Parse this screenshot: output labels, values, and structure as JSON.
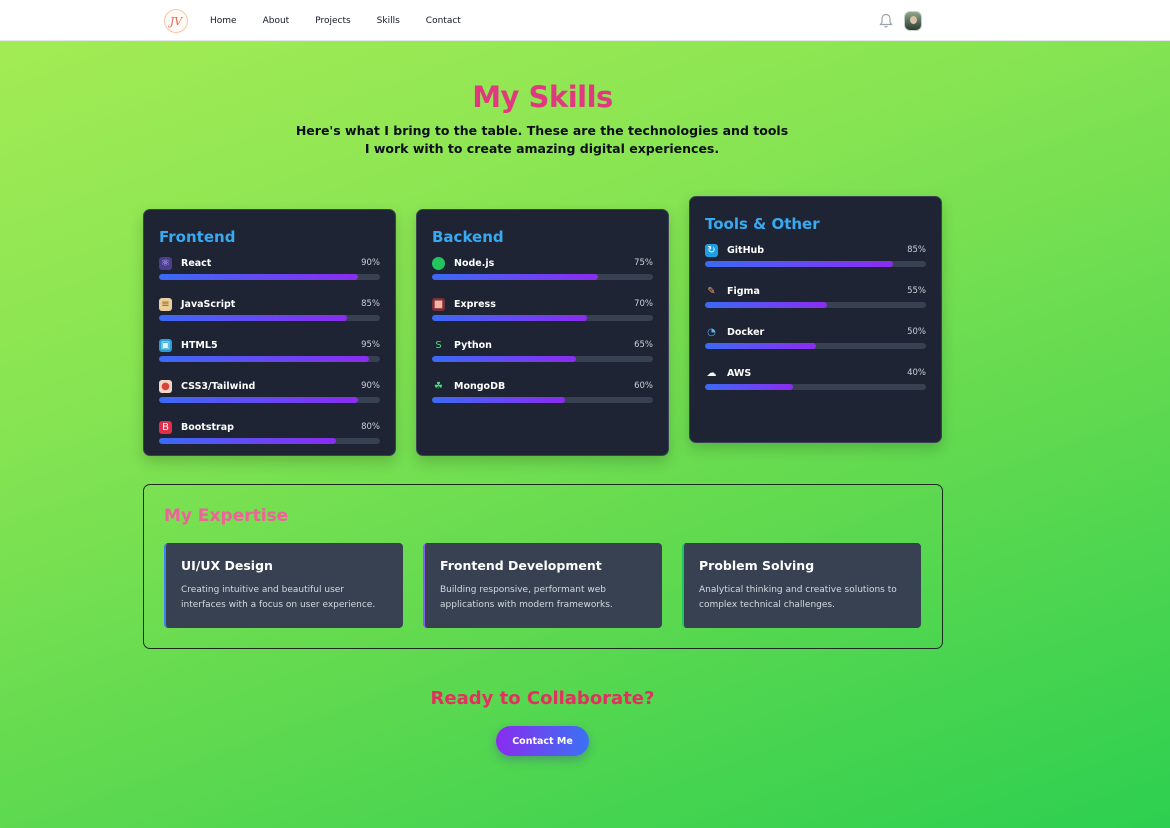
{
  "nav": {
    "logo_text": "JV",
    "links": [
      "Home",
      "About",
      "Projects",
      "Skills",
      "Contact"
    ],
    "icons": [
      "bell-icon",
      "avatar"
    ]
  },
  "hero": {
    "title": "My Skills",
    "subtitle": "Here's what I bring to the table. These are the technologies and tools I work with to create amazing digital experiences."
  },
  "skill_groups": [
    {
      "title": "Frontend",
      "skills": [
        {
          "name": "React",
          "percent": 90,
          "percent_label": "90%",
          "icon": "react-icon"
        },
        {
          "name": "JavaScript",
          "percent": 85,
          "percent_label": "85%",
          "icon": "scroll-icon"
        },
        {
          "name": "HTML5",
          "percent": 95,
          "percent_label": "95%",
          "icon": "monitor-icon"
        },
        {
          "name": "CSS3/Tailwind",
          "percent": 90,
          "percent_label": "90%",
          "icon": "palette-icon"
        },
        {
          "name": "Bootstrap",
          "percent": 80,
          "percent_label": "80%",
          "icon": "bootstrap-icon"
        }
      ]
    },
    {
      "title": "Backend",
      "skills": [
        {
          "name": "Node.js",
          "percent": 75,
          "percent_label": "75%",
          "icon": "green-circle-icon"
        },
        {
          "name": "Express",
          "percent": 70,
          "percent_label": "70%",
          "icon": "train-icon"
        },
        {
          "name": "Python",
          "percent": 65,
          "percent_label": "65%",
          "icon": "snake-icon"
        },
        {
          "name": "MongoDB",
          "percent": 60,
          "percent_label": "60%",
          "icon": "leaf-icon"
        }
      ]
    },
    {
      "title": "Tools & Other",
      "skills": [
        {
          "name": "GitHub",
          "percent": 85,
          "percent_label": "85%",
          "icon": "sync-icon"
        },
        {
          "name": "Figma",
          "percent": 55,
          "percent_label": "55%",
          "icon": "pencil-icon"
        },
        {
          "name": "Docker",
          "percent": 50,
          "percent_label": "50%",
          "icon": "whale-icon"
        },
        {
          "name": "AWS",
          "percent": 40,
          "percent_label": "40%",
          "icon": "cloud-icon"
        }
      ]
    }
  ],
  "expertise": {
    "title": "My Expertise",
    "cards": [
      {
        "title": "UI/UX Design",
        "text": "Creating intuitive and beautiful user interfaces with a focus on user experience.",
        "accent": "#3b82f6"
      },
      {
        "title": "Frontend Development",
        "text": "Building responsive, performant web applications with modern frameworks.",
        "accent": "#8b5cf6"
      },
      {
        "title": "Problem Solving",
        "text": "Analytical thinking and creative solutions to complex technical challenges.",
        "accent": "#22c55e"
      }
    ]
  },
  "cta": {
    "title": "Ready to Collaborate?",
    "button_label": "Contact Me"
  },
  "colors": {
    "title": "#e0397f",
    "card_bg": "#1e2433",
    "card_heading": "#39a9f0",
    "bar_start": "#3b6af5",
    "bar_end": "#8b2cf0",
    "cta_title": "#e2305f"
  }
}
